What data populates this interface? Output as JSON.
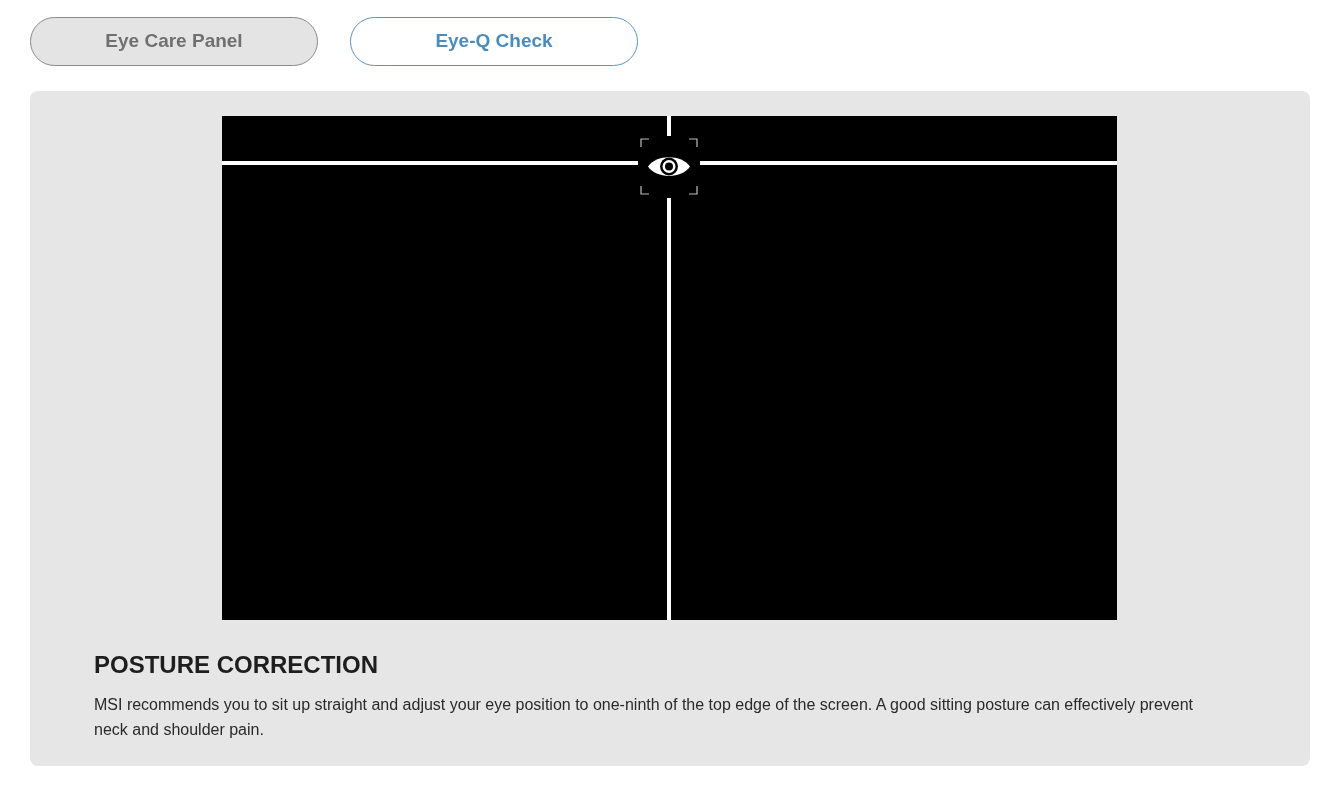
{
  "tabs": [
    {
      "label": "Eye Care Panel",
      "selected": false
    },
    {
      "label": "Eye-Q Check",
      "selected": true
    }
  ],
  "section": {
    "title": "POSTURE CORRECTION",
    "description": "MSI recommends you to sit up straight and adjust your eye position to one-ninth of the top edge of the screen. A good sitting posture can effectively prevent neck and shoulder pain."
  }
}
